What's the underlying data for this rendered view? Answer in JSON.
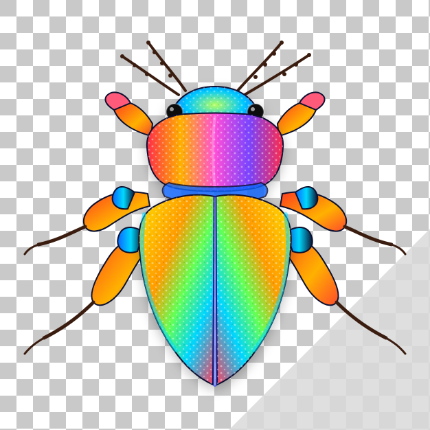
{
  "background": {
    "pattern": "transparency-checkerboard",
    "colors": {
      "dark": "#c9c9c9",
      "light": "#ffffff",
      "shade": "#dadada"
    }
  },
  "subject": {
    "name": "iridescent-beetle",
    "palette": {
      "elytra": [
        "#ff4d6d",
        "#ffb000",
        "#f7ff00",
        "#3cff5a",
        "#00d9ff",
        "#2a5cff",
        "#a52bff"
      ],
      "pronotum": [
        "#ff2d55",
        "#ffbf00",
        "#ff4fd8",
        "#7a44ff",
        "#00c2ff"
      ],
      "legs": [
        "#ff3b1f",
        "#ffb100",
        "#0b1030",
        "#0a66ff"
      ],
      "antenna": "#3b1d10"
    }
  }
}
